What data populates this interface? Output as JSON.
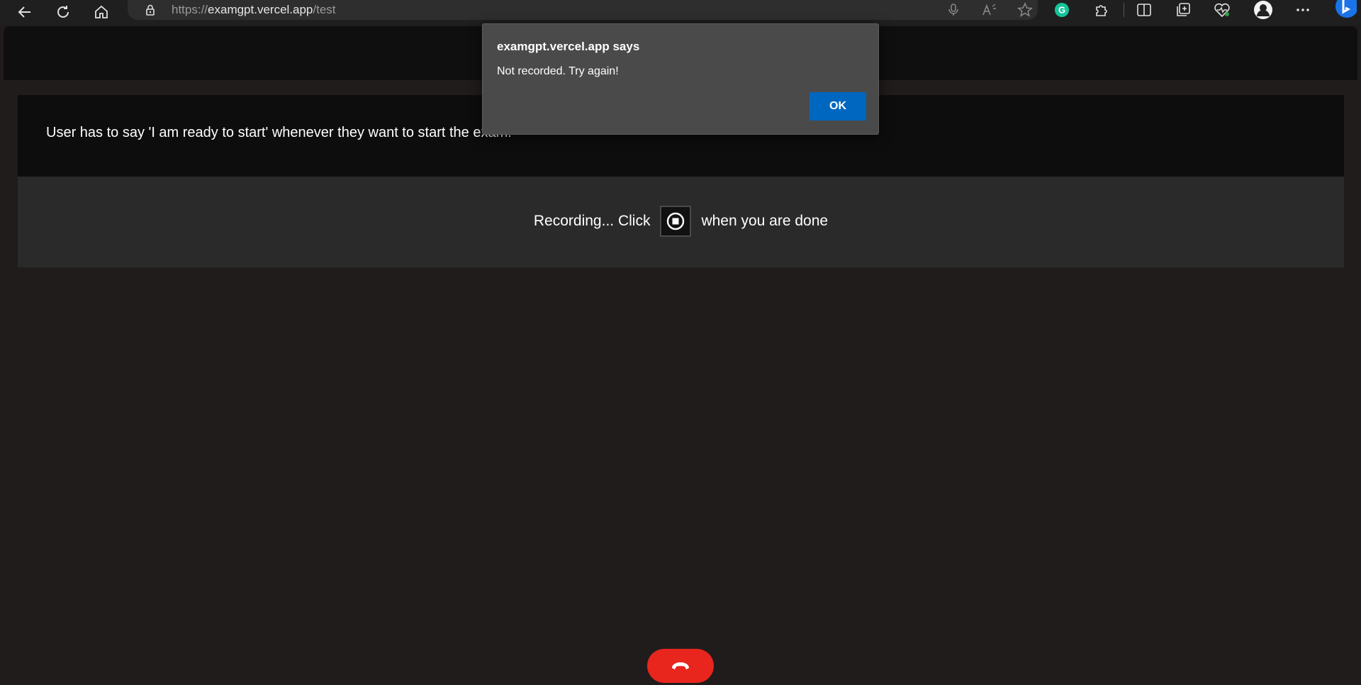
{
  "browser": {
    "url_scheme": "https://",
    "url_host": "examgpt.vercel.app",
    "url_path": "/test",
    "icons": [
      "back-arrow-icon",
      "refresh-icon",
      "home-icon",
      "lock-icon",
      "microphone-icon",
      "read-aloud-icon",
      "favorite-star-icon",
      "grammarly-icon",
      "extensions-icon",
      "split-screen-icon",
      "collections-icon",
      "browser-essentials-icon",
      "profile-avatar-icon",
      "more-menu-icon",
      "bing-copilot-icon"
    ],
    "accent": "#1a73e8"
  },
  "page": {
    "instruction": "User has to say 'I am ready to start' whenever they want to start the exam.",
    "recording_prefix": "Recording... Click",
    "recording_suffix": "when you are done",
    "end_call_color": "#e8261e"
  },
  "alert": {
    "title": "examgpt.vercel.app says",
    "message": "Not recorded. Try again!",
    "ok_label": "OK",
    "ok_color": "#0067c0"
  }
}
